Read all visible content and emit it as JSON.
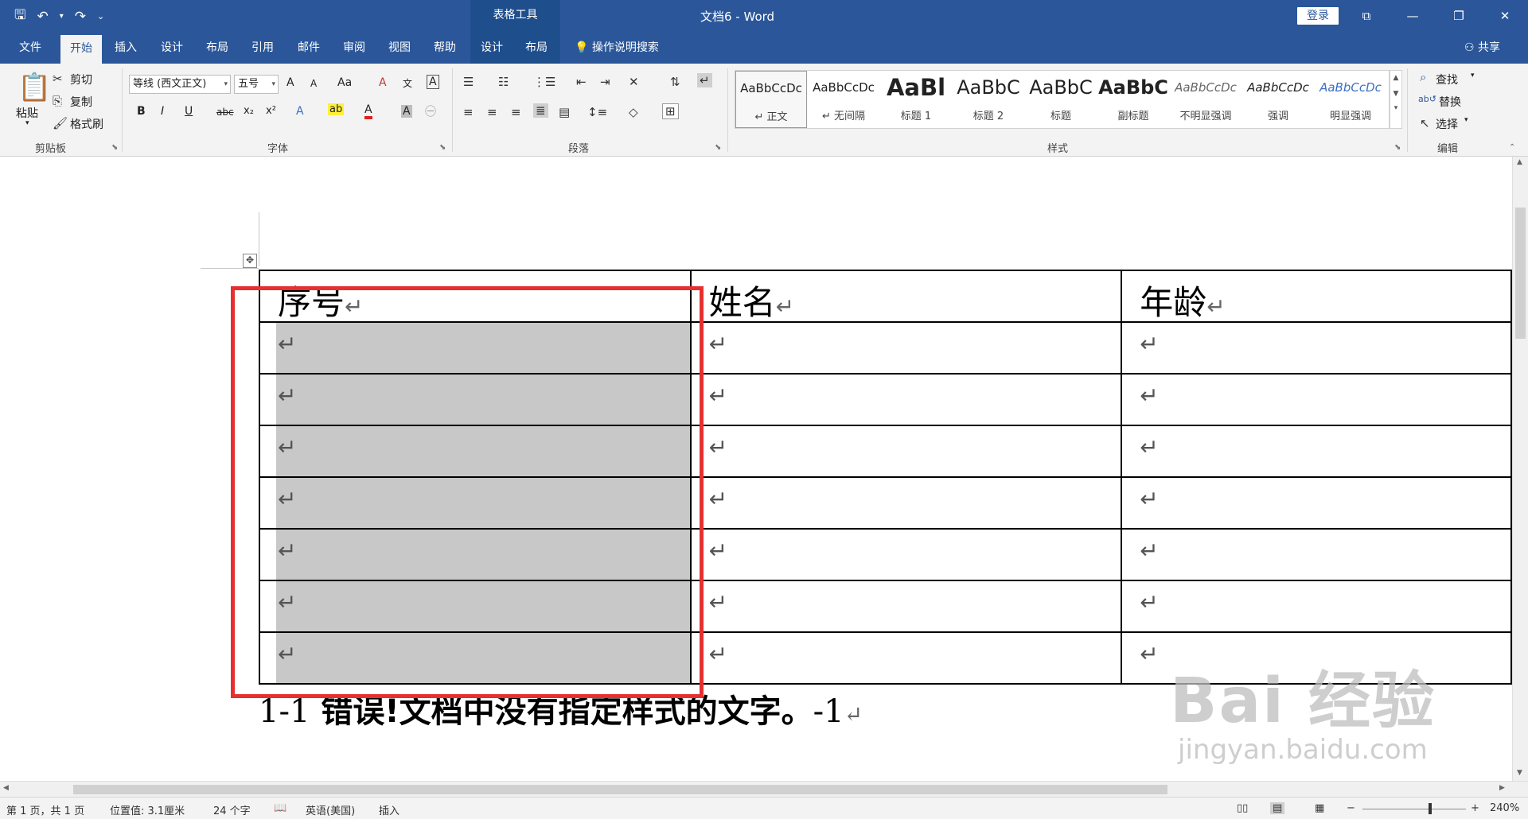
{
  "titlebar": {
    "doc_title": "文档6 - Word",
    "context_label": "表格工具",
    "login_label": "登录",
    "qat": {
      "save": "🖫",
      "undo": "↶",
      "undo_dd": "▾",
      "redo": "↷",
      "customize": "⌄"
    },
    "win_controls": {
      "ribbon_display": "⧉",
      "minimize": "—",
      "restore": "❐",
      "close": "✕"
    }
  },
  "tabs": [
    {
      "label": "文件"
    },
    {
      "label": "开始"
    },
    {
      "label": "插入"
    },
    {
      "label": "设计"
    },
    {
      "label": "布局"
    },
    {
      "label": "引用"
    },
    {
      "label": "邮件"
    },
    {
      "label": "审阅"
    },
    {
      "label": "视图"
    },
    {
      "label": "帮助"
    },
    {
      "label": "设计"
    },
    {
      "label": "布局"
    }
  ],
  "tell_me": "操作说明搜索",
  "share_label": "共享",
  "clipboard": {
    "group_label": "剪贴板",
    "paste": "粘贴",
    "cut": "剪切",
    "copy": "复制",
    "format_painter": "格式刷"
  },
  "font": {
    "group_label": "字体",
    "font_name": "等线 (西文正文)",
    "font_size": "五号",
    "grow": "A",
    "shrink": "A",
    "change_case": "Aa",
    "clear": "A",
    "phonetic": "文",
    "border_char": "A",
    "bold": "B",
    "italic": "I",
    "underline": "U",
    "strike": "abc",
    "subscript": "x₂",
    "superscript": "x²",
    "text_effects": "A",
    "highlight": "ab",
    "font_color": "A",
    "shading": "A",
    "enclose": "㊀"
  },
  "paragraph": {
    "group_label": "段落"
  },
  "styles": {
    "group_label": "样式",
    "items": [
      {
        "sample": "AaBbCcDc",
        "name": "↵ 正文"
      },
      {
        "sample": "AaBbCcDc",
        "name": "↵ 无间隔"
      },
      {
        "sample": "AaBl",
        "name": "标题 1"
      },
      {
        "sample": "AaBbC",
        "name": "标题 2"
      },
      {
        "sample": "AaBbC",
        "name": "标题"
      },
      {
        "sample": "AaBbC",
        "name": "副标题"
      },
      {
        "sample": "AaBbCcDc",
        "name": "不明显强调"
      },
      {
        "sample": "AaBbCcDc",
        "name": "强调"
      },
      {
        "sample": "AaBbCcDc",
        "name": "明显强调"
      }
    ]
  },
  "editing": {
    "group_label": "编辑",
    "find": "查找",
    "replace": "替换",
    "select": "选择"
  },
  "table": {
    "headers": [
      "序号",
      "姓名",
      "年龄"
    ],
    "para_mark": "↵",
    "cell_mark": "↵"
  },
  "caption": {
    "prefix": "1-1",
    "bold_text": " 错误!文档中没有指定样式的文字。",
    "suffix": "-1",
    "mark": "↵"
  },
  "watermark": {
    "brand": "Bai 经验",
    "url": "jingyan.baidu.com"
  },
  "status": {
    "page": "第 1 页，共 1 页",
    "position": "位置值: 3.1厘米",
    "words": "24 个字",
    "language": "英语(美国)",
    "mode": "插入",
    "zoom": "240%",
    "zoom_minus": "−",
    "zoom_plus": "+"
  }
}
